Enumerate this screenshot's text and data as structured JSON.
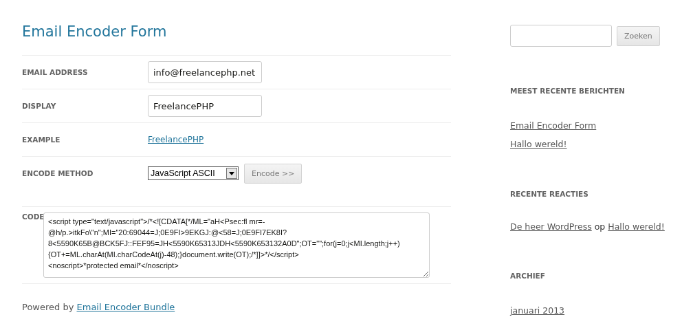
{
  "title": "Email Encoder Form",
  "form": {
    "rows": [
      {
        "kind": "input",
        "label": "EMAIL ADDRESS",
        "value": "info@freelancephp.net"
      },
      {
        "kind": "input",
        "label": "DISPLAY",
        "value": "FreelancePHP"
      },
      {
        "kind": "link",
        "label": "EXAMPLE",
        "value": "FreelancePHP"
      },
      {
        "kind": "select",
        "label": "ENCODE METHOD",
        "value": "JavaScript ASCII",
        "button": "Encode >>"
      },
      {
        "kind": "code",
        "label": "CODE",
        "value": "<script type=\"text/javascript\">/*<![CDATA[*/ML=\"aH<Psec:fl mr=-@h/p.>itkFo\\\"n\";MI=\"20:69044=J;0E9FI>9EKGJ:@<58=J;0E9FI7EK8I?8<5590K65B@BCK5FJ::FEF95=JH<5590K65313JDH<5590K653132A0D\";OT=\"\";for(j=0;j<MI.length;j++){OT+=ML.charAt(MI.charCodeAt(j)-48);}document.write(OT);/*]]>*/</script>\n<noscript>*protected email*</noscript>"
      }
    ]
  },
  "footer": {
    "text": "Powered by",
    "link": "Email Encoder Bundle"
  },
  "sidebar": {
    "search_button": "Zoeken",
    "widgets": [
      {
        "kind": "links",
        "title": "MEEST RECENTE BERICHTEN",
        "items": [
          "Email Encoder Form",
          "Hallo wereld!"
        ]
      },
      {
        "kind": "comments",
        "title": "RECENTE REACTIES",
        "items": [
          {
            "author": "De heer WordPress",
            "word": "op",
            "post": "Hallo wereld!"
          }
        ]
      },
      {
        "kind": "links",
        "title": "ARCHIEF",
        "items": [
          "januari 2013"
        ]
      }
    ]
  }
}
